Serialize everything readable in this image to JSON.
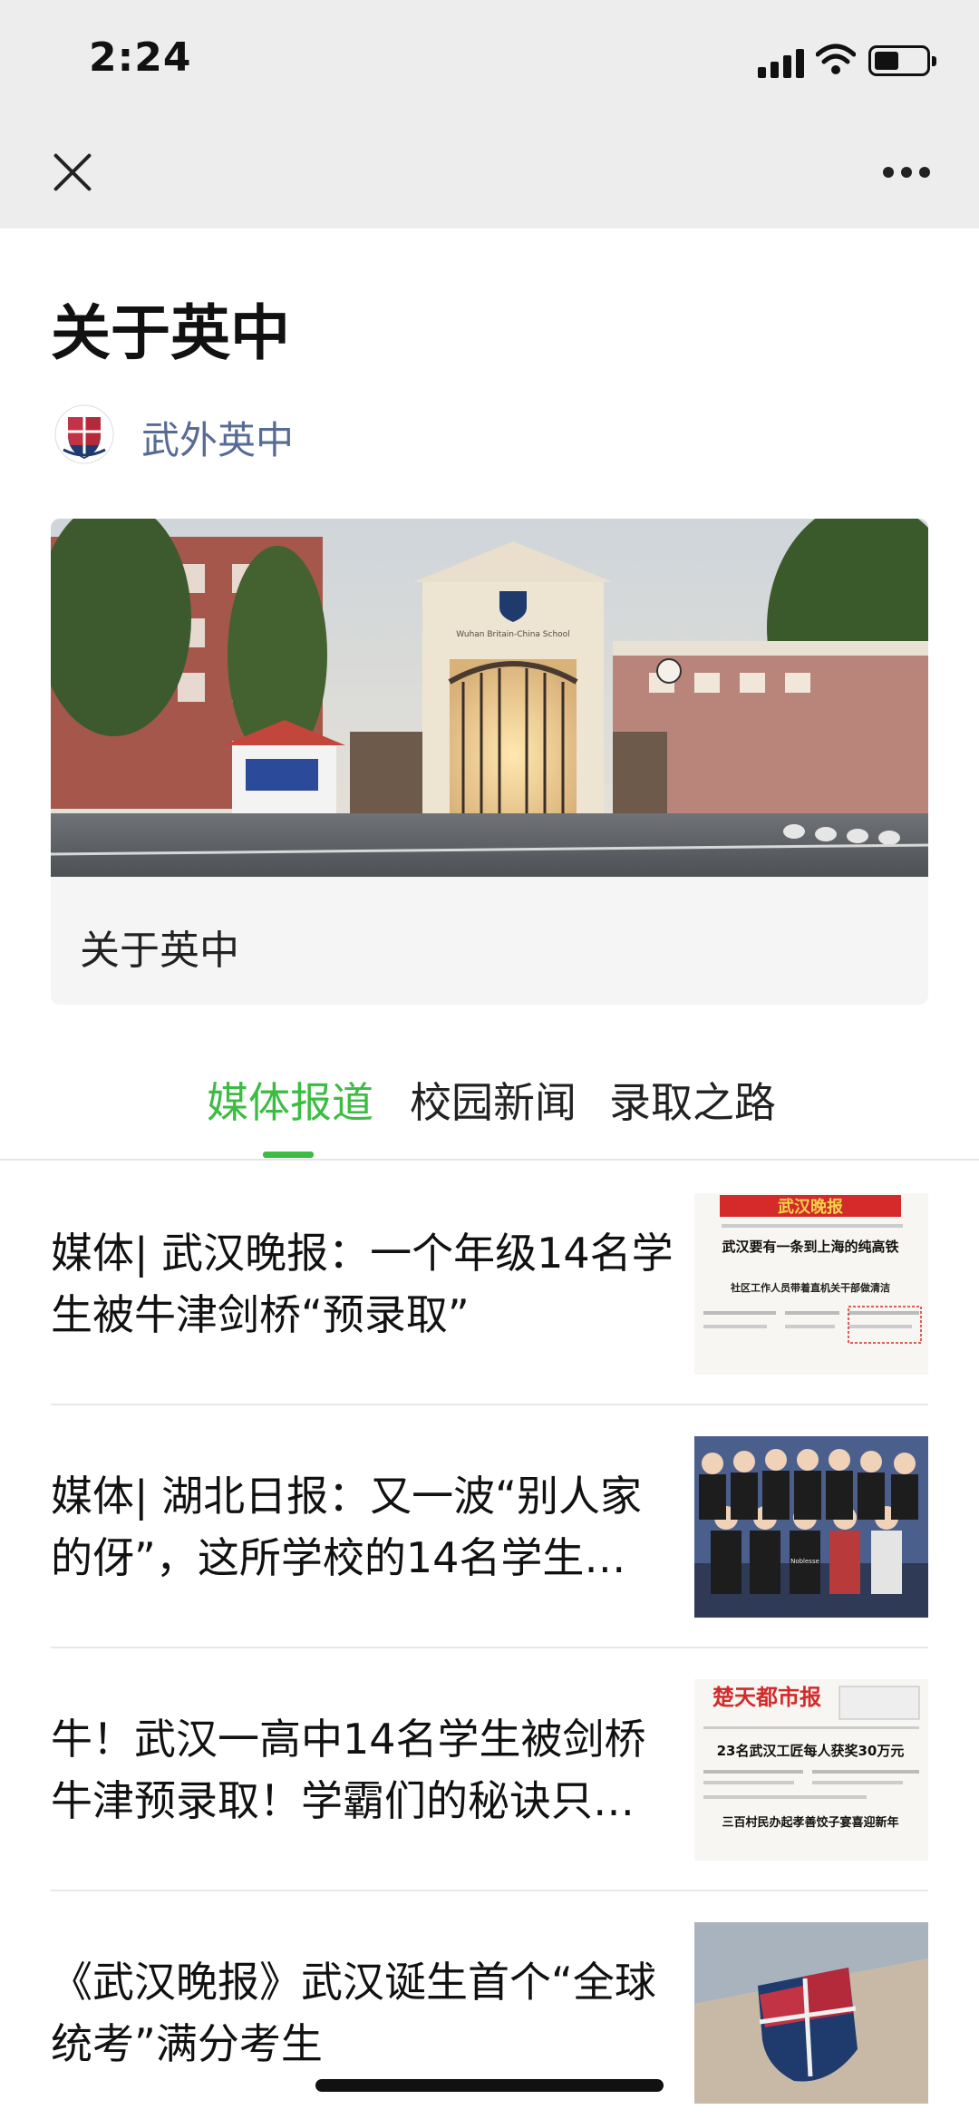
{
  "status_bar": {
    "time": "2:24"
  },
  "page": {
    "title": "关于英中",
    "author": "武外英中",
    "banner": {
      "caption": "关于英中",
      "gate_sign": "Wuhan Britain-China School"
    }
  },
  "tabs": [
    {
      "label": "媒体报道",
      "active": true
    },
    {
      "label": "校园新闻",
      "active": false
    },
    {
      "label": "录取之路",
      "active": false
    }
  ],
  "articles": [
    {
      "title": "媒体| 武汉晚报：一个年级14名学生被牛津剑桥“预录取”",
      "thumb": {
        "masthead": "武汉晚报",
        "line1": "武汉要有一条到上海的纯高铁",
        "line2": "社区工作人员带着直机关干部做清洁"
      }
    },
    {
      "title": "媒体| 湖北日报：又一波“别人家的伢”，这所学校的14名学生…",
      "thumb": {
        "shirt_text": "Noblesse"
      }
    },
    {
      "title": "牛！武汉一高中14名学生被剑桥牛津预录取！学霸们的秘诀只…",
      "thumb": {
        "masthead": "楚天都市报",
        "line1": "23名武汉工匠每人获奖30万元",
        "line2": "三百村民办起孝善饺子宴喜迎新年"
      }
    },
    {
      "title": "《武汉晚报》武汉诞生首个“全球统考”满分考生",
      "thumb": {}
    }
  ],
  "colors": {
    "accent": "#3cbc43",
    "link": "#576b95",
    "topbar": "#ededed"
  }
}
